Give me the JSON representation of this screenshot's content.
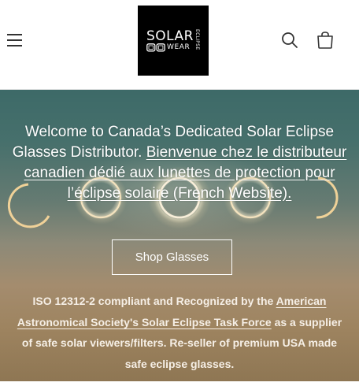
{
  "header": {
    "logo": {
      "word_solar": "SOLAR",
      "word_eyewear": "WEAR",
      "word_eclipse": "ECLIPSE"
    }
  },
  "hero": {
    "intro_text": "Welcome to Canada’s Dedicated Solar Eclipse Glasses Distributor.",
    "french_link": "Bienvenue chez le distributeur canadien dédié aux lunettes de protection pour l’éclipse solaire (French Website).",
    "shop_button": "Shop Glasses",
    "compliance_prefix": "ISO 12312-2 compliant and Recognized by the",
    "compliance_link": "American Astronomical Society's Solar Eclipse Task Force",
    "compliance_suffix": "as a supplier of safe solar viewers/filters. Re-seller of premium USA made safe eclipse glasses."
  },
  "colors": {
    "header_bg": "#ffffff",
    "logo_bg": "#000000",
    "hero_top": "#3d6a68",
    "hero_bottom": "#8d7552",
    "text_on_hero": "#ffffff"
  }
}
